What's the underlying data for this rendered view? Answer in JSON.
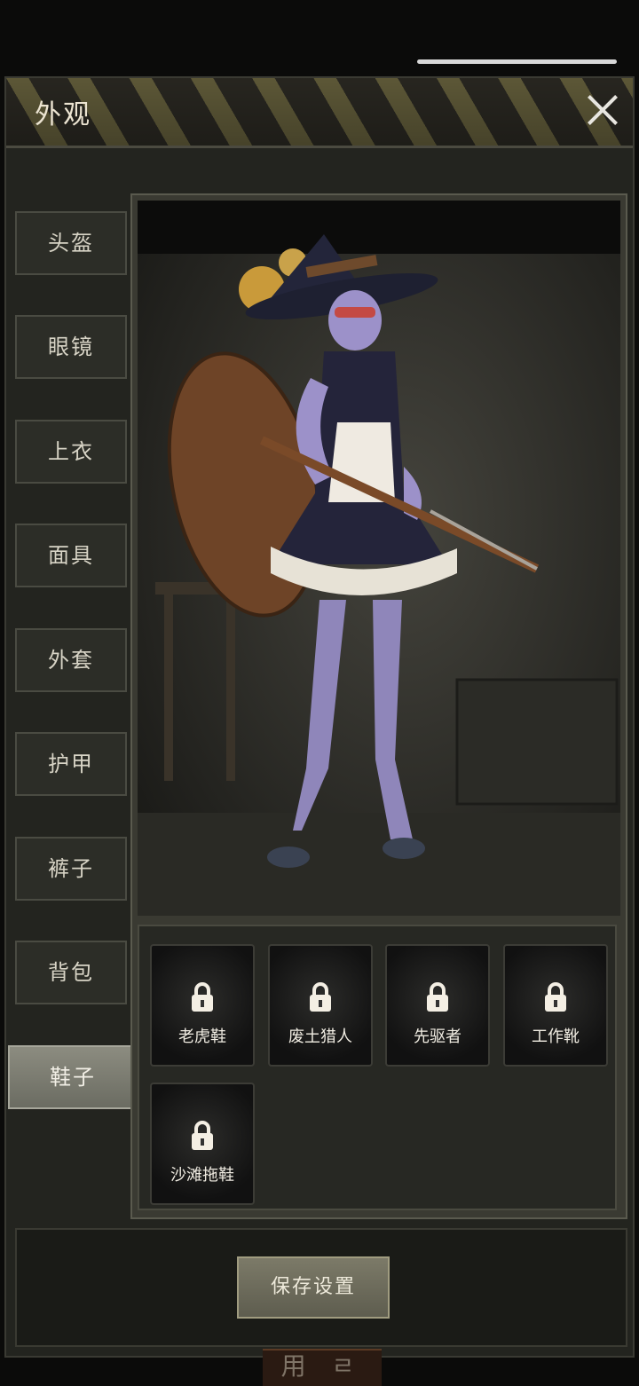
{
  "header": {
    "title": "外观"
  },
  "tabs": [
    {
      "label": "头盔"
    },
    {
      "label": "眼镜"
    },
    {
      "label": "上衣"
    },
    {
      "label": "面具"
    },
    {
      "label": "外套"
    },
    {
      "label": "护甲"
    },
    {
      "label": "裤子"
    },
    {
      "label": "背包"
    },
    {
      "label": "鞋子",
      "active": true
    }
  ],
  "shoe_items": [
    {
      "name": "老虎鞋",
      "locked": true
    },
    {
      "name": "废土猎人",
      "locked": true
    },
    {
      "name": "先驱者",
      "locked": true
    },
    {
      "name": "工作靴",
      "locked": true
    },
    {
      "name": "沙滩拖鞋",
      "locked": true
    }
  ],
  "footer": {
    "save_label": "保存设置"
  },
  "bottom_peek_text": "用 ㄹ"
}
